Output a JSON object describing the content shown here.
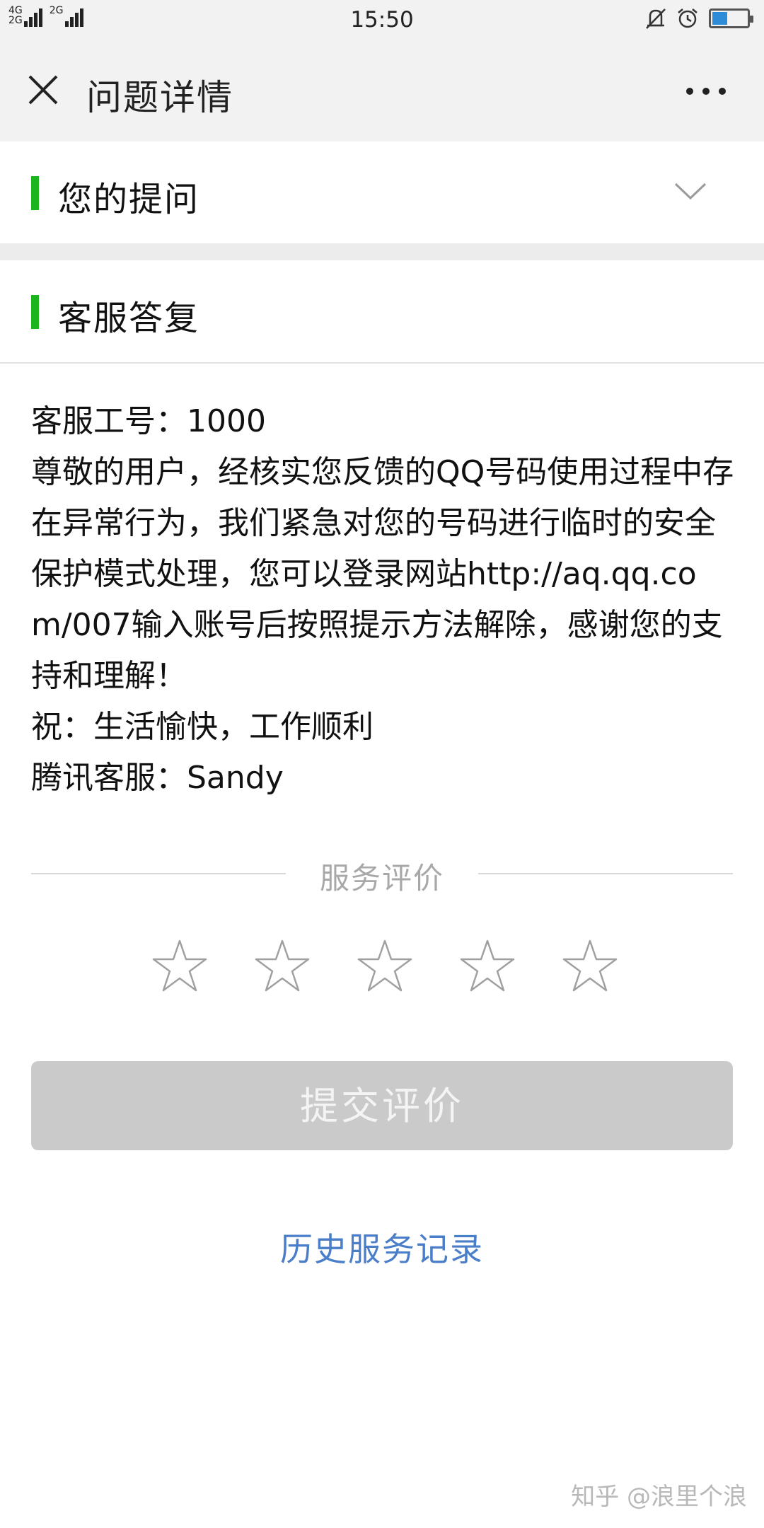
{
  "status_bar": {
    "network_top": "4G",
    "network_bottom": "2G",
    "network_second": "2G",
    "time": "15:50",
    "icons": [
      "mute-vibrate-icon",
      "alarm-icon",
      "battery-icon"
    ],
    "battery_level": 0.45
  },
  "nav": {
    "close_icon": "close-icon",
    "title": "问题详情",
    "more_icon": "more-icon"
  },
  "question_section": {
    "title": "您的提问",
    "accent_color": "#1db51d",
    "expand_icon": "chevron-down-icon"
  },
  "reply_section": {
    "title": "客服答复",
    "lines": [
      "客服工号：1000",
      "尊敬的用户，经核实您反馈的QQ号码使用过程中存在异常行为，我们紧急对您的号码进行临时的安全保护模式处理，您可以登录网站http://aq.qq.com/007输入账号后按照提示方法解除，感谢您的支持和理解！",
      "祝：生活愉快，工作顺利",
      "腾讯客服：Sandy"
    ]
  },
  "rating": {
    "label": "服务评价",
    "stars_total": 5,
    "stars_selected": 0
  },
  "submit_label": "提交评价",
  "history_link": "历史服务记录",
  "watermark": "知乎 @浪里个浪",
  "colors": {
    "link": "#4a7ec9",
    "button_disabled": "#cacaca",
    "header_bg": "#f2f2f2"
  }
}
